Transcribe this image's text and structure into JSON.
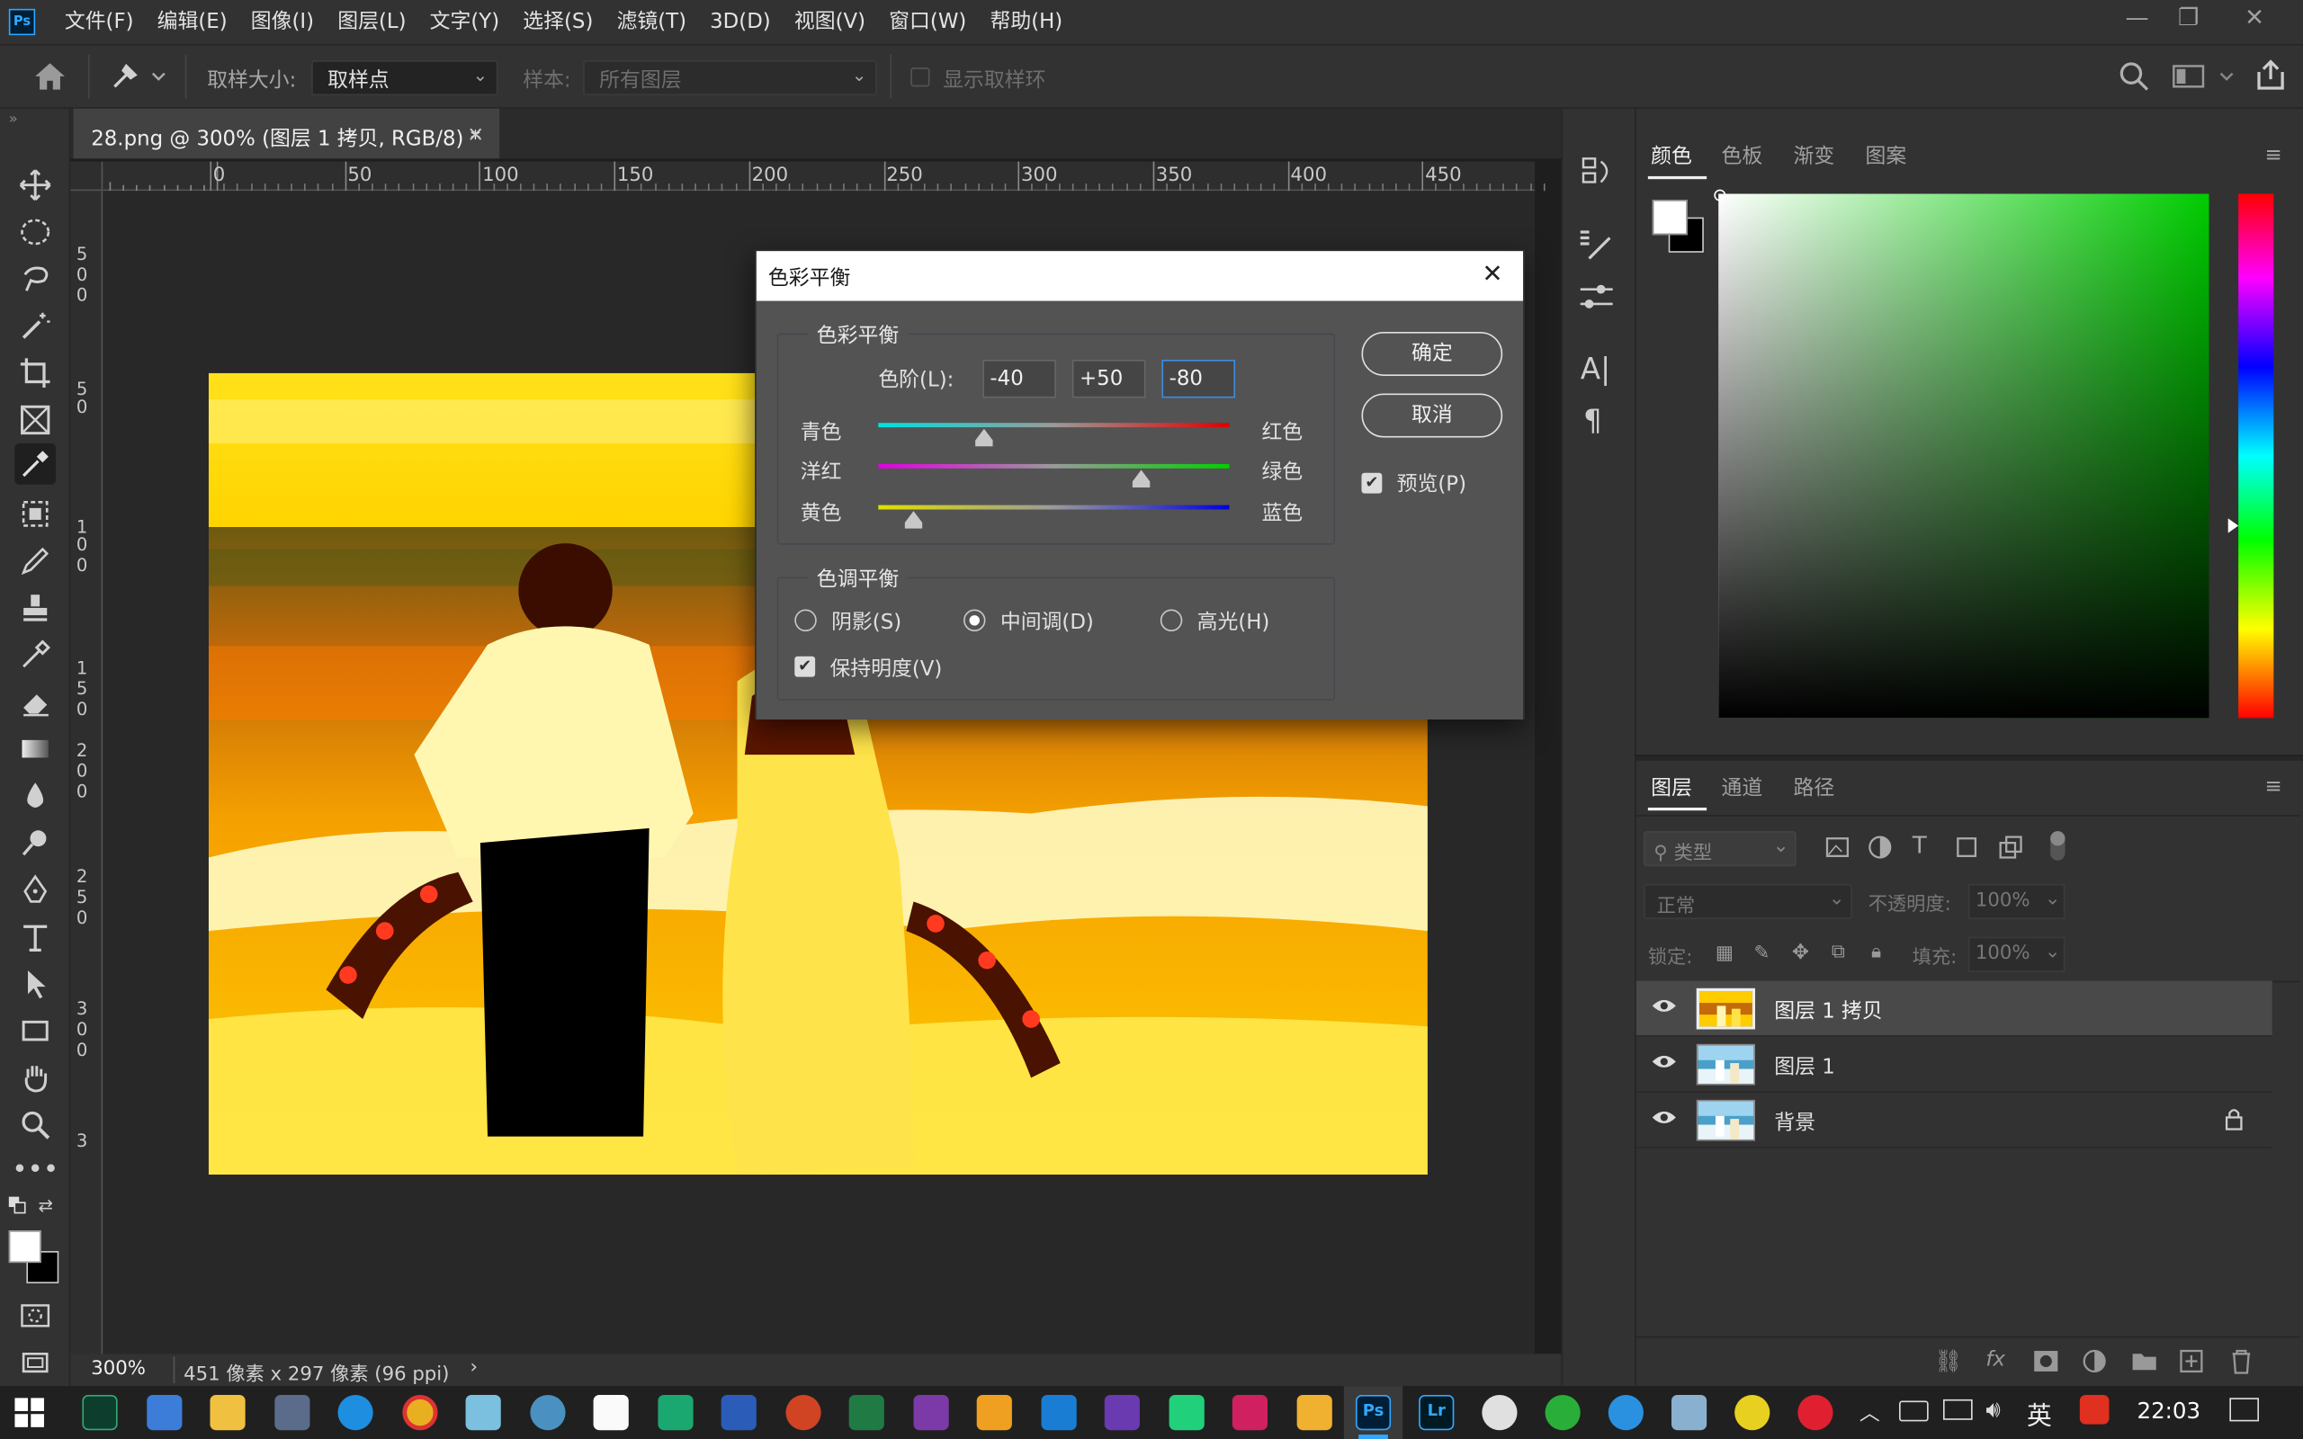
{
  "app": {
    "logo": "Ps",
    "accent": "#31a8ff"
  },
  "menu": [
    "文件(F)",
    "编辑(E)",
    "图像(I)",
    "图层(L)",
    "文字(Y)",
    "选择(S)",
    "滤镜(T)",
    "3D(D)",
    "视图(V)",
    "窗口(W)",
    "帮助(H)"
  ],
  "options": {
    "sample_size_label": "取样大小:",
    "sample_size_value": "取样点",
    "sample_label": "样本:",
    "sample_value": "所有图层",
    "show_ring_label": "显示取样环"
  },
  "document": {
    "tab_title": "28.png @ 300% (图层 1 拷贝, RGB/8) *",
    "close_glyph": "×",
    "ruler_h": [
      "0",
      "50",
      "100",
      "150",
      "200",
      "250",
      "300",
      "350",
      "400",
      "450"
    ],
    "ruler_v": [
      "5",
      "0",
      "0",
      "5",
      "0",
      "1",
      "0",
      "0",
      "1",
      "5",
      "0",
      "2",
      "0",
      "0",
      "2",
      "5",
      "0",
      "3",
      "0",
      "0",
      "3"
    ]
  },
  "status": {
    "zoom": "300%",
    "info": "451 像素 x 297 像素 (96 ppi)",
    "arrow": "›"
  },
  "dialog": {
    "title": "色彩平衡",
    "close_glyph": "✕",
    "color_balance_group": "色彩平衡",
    "levels_label": "色阶(L):",
    "levels": [
      "-40",
      "+50",
      "-80"
    ],
    "sliders": [
      {
        "left": "青色",
        "right": "红色",
        "value": -40
      },
      {
        "left": "洋红",
        "right": "绿色",
        "value": 50
      },
      {
        "left": "黄色",
        "right": "蓝色",
        "value": -80
      }
    ],
    "tone_group": "色调平衡",
    "tones": [
      "阴影(S)",
      "中间调(D)",
      "高光(H)"
    ],
    "selected_tone": "中间调(D)",
    "preserve_luminosity": "保持明度(V)",
    "ok": "确定",
    "cancel": "取消",
    "preview": "预览(P)"
  },
  "color_panel": {
    "tabs": [
      "颜色",
      "色板",
      "渐变",
      "图案"
    ],
    "active": "颜色",
    "hue_color": "#00cc00"
  },
  "layers_panel": {
    "tabs": [
      "图层",
      "通道",
      "路径"
    ],
    "active": "图层",
    "filter_kind": "类型",
    "blend_mode": "正常",
    "opacity_label": "不透明度:",
    "opacity_value": "100%",
    "lock_label": "锁定:",
    "fill_label": "填充:",
    "fill_value": "100%",
    "layers": [
      {
        "name": "图层 1 拷贝",
        "selected": true
      },
      {
        "name": "图层 1",
        "selected": false
      },
      {
        "name": "背景",
        "selected": false,
        "locked": true
      }
    ]
  },
  "taskbar": {
    "ime": "英",
    "time": "22:03",
    "ps_label": "Ps",
    "lr_label": "Lr"
  }
}
